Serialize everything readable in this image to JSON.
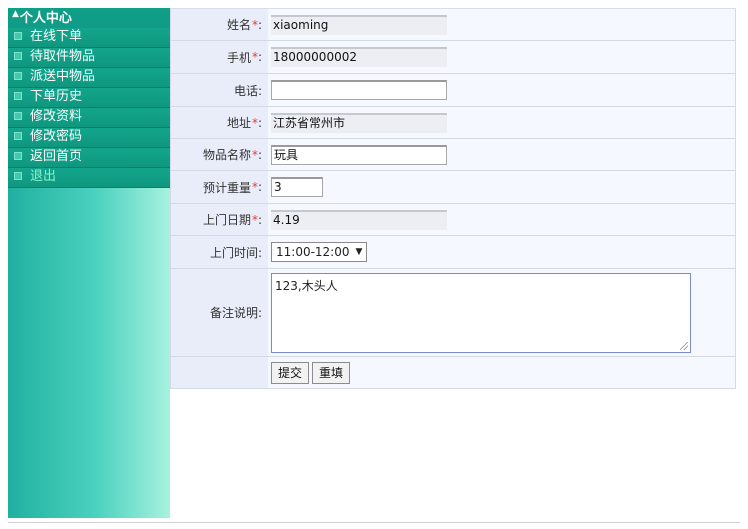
{
  "sidebar": {
    "title": "个人中心",
    "items": [
      {
        "label": "在线下单"
      },
      {
        "label": "待取件物品"
      },
      {
        "label": "派送中物品"
      },
      {
        "label": "下单历史"
      },
      {
        "label": "修改资料"
      },
      {
        "label": "修改密码"
      },
      {
        "label": "返回首页"
      },
      {
        "label": "退出"
      }
    ]
  },
  "form": {
    "required_mark": "*",
    "name": {
      "label": "姓名",
      "value": "xiaoming"
    },
    "mobile": {
      "label": "手机",
      "value": "18000000002"
    },
    "phone": {
      "label": "电话:",
      "value": ""
    },
    "address": {
      "label": "地址",
      "value": "江苏省常州市"
    },
    "item_name": {
      "label": "物品名称",
      "value": "玩具"
    },
    "weight": {
      "label": "预计重量",
      "value": "3"
    },
    "pickup_date": {
      "label": "上门日期",
      "value": "4.19"
    },
    "pickup_time": {
      "label": "上门时间:",
      "value": "11:00-12:00"
    },
    "remarks": {
      "label": "备注说明:",
      "value": "123,木头人"
    },
    "submit_label": "提交",
    "reset_label": "重填"
  },
  "colors": {
    "accent": "#119c88",
    "label_bg": "#e9edf9",
    "value_bg": "#f6f8ff",
    "required": "#e23b3b"
  }
}
